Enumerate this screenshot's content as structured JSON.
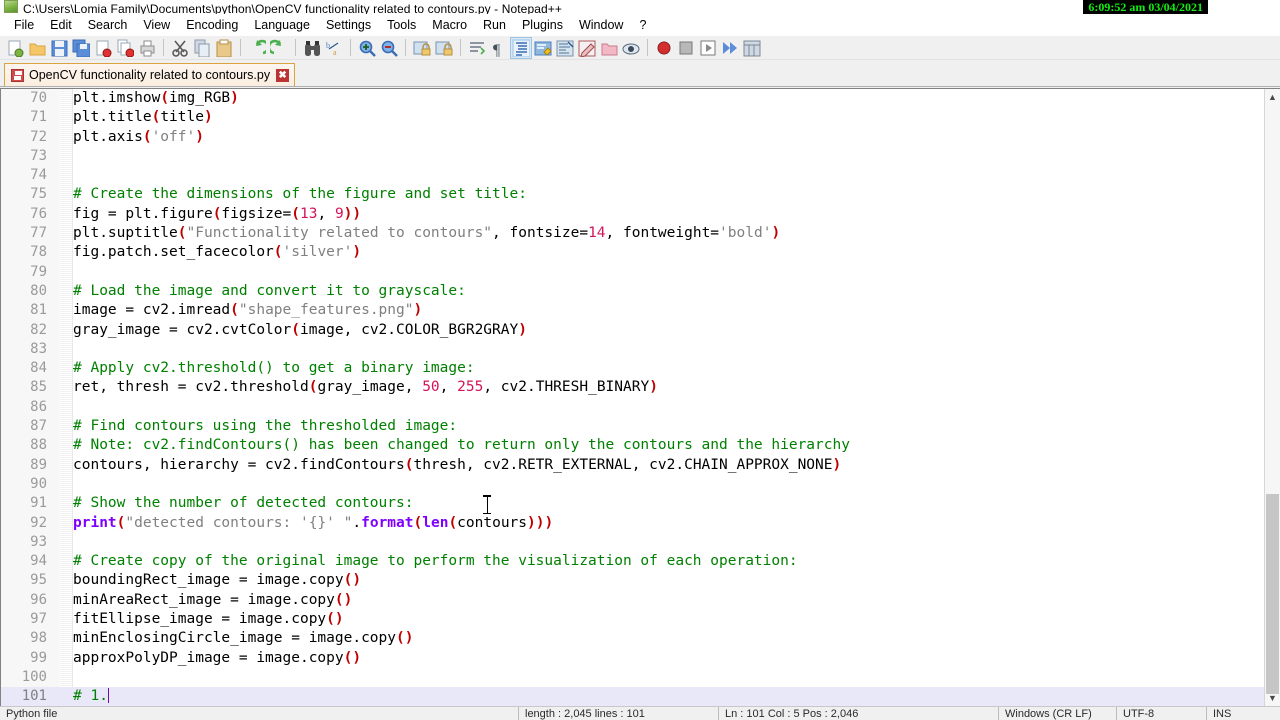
{
  "window": {
    "title": "C:\\Users\\Lomia Family\\Documents\\python\\OpenCV functionality related to contours.py - Notepad++",
    "app_icon": "notepad-plus-plus-icon",
    "close_label": "X",
    "clock_overlay": "6:09:52 am 03/04/2021"
  },
  "menubar": {
    "items": [
      {
        "label": "File"
      },
      {
        "label": "Edit"
      },
      {
        "label": "Search"
      },
      {
        "label": "View"
      },
      {
        "label": "Encoding"
      },
      {
        "label": "Language"
      },
      {
        "label": "Settings"
      },
      {
        "label": "Tools"
      },
      {
        "label": "Macro"
      },
      {
        "label": "Run"
      },
      {
        "label": "Plugins"
      },
      {
        "label": "Window"
      },
      {
        "label": "?"
      }
    ]
  },
  "toolbar": {
    "buttons": [
      {
        "name": "new-file-icon"
      },
      {
        "name": "open-file-icon"
      },
      {
        "name": "save-icon"
      },
      {
        "name": "save-all-icon"
      },
      {
        "name": "close-file-icon"
      },
      {
        "name": "close-all-files-icon"
      },
      {
        "name": "print-icon"
      },
      {
        "name": "separator"
      },
      {
        "name": "cut-icon"
      },
      {
        "name": "copy-icon"
      },
      {
        "name": "paste-icon"
      },
      {
        "name": "separator"
      },
      {
        "name": "undo-icon"
      },
      {
        "name": "redo-icon"
      },
      {
        "name": "separator"
      },
      {
        "name": "find-icon"
      },
      {
        "name": "replace-icon"
      },
      {
        "name": "separator"
      },
      {
        "name": "zoom-in-icon"
      },
      {
        "name": "zoom-out-icon"
      },
      {
        "name": "separator"
      },
      {
        "name": "sync-vertical-scroll-icon"
      },
      {
        "name": "sync-horizontal-scroll-icon"
      },
      {
        "name": "separator"
      },
      {
        "name": "word-wrap-icon"
      },
      {
        "name": "show-all-characters-icon"
      },
      {
        "name": "indent-guideline-icon"
      },
      {
        "name": "user-defined-dialog-icon"
      },
      {
        "name": "document-map-icon"
      },
      {
        "name": "function-list-icon"
      },
      {
        "name": "folder-as-workspace-icon"
      },
      {
        "name": "monitoring-icon"
      },
      {
        "name": "separator"
      },
      {
        "name": "record-macro-icon"
      },
      {
        "name": "stop-recording-icon"
      },
      {
        "name": "play-macro-icon"
      },
      {
        "name": "run-macro-multiple-icon"
      },
      {
        "name": "save-macro-icon"
      }
    ]
  },
  "tabs": [
    {
      "label": "OpenCV functionality related to contours.py",
      "icon": "saved-document-icon",
      "close_label": "✖",
      "active": true
    }
  ],
  "editor": {
    "first_visible_line": 70,
    "current_line": 101,
    "lines": [
      {
        "n": 70,
        "tokens": [
          {
            "t": "plt.imshow",
            "c": "op"
          },
          {
            "t": "(",
            "c": "par"
          },
          {
            "t": "img_RGB",
            "c": "op"
          },
          {
            "t": ")",
            "c": "par"
          }
        ]
      },
      {
        "n": 71,
        "tokens": [
          {
            "t": "plt.title",
            "c": "op"
          },
          {
            "t": "(",
            "c": "par"
          },
          {
            "t": "title",
            "c": "op"
          },
          {
            "t": ")",
            "c": "par"
          }
        ]
      },
      {
        "n": 72,
        "tokens": [
          {
            "t": "plt.axis",
            "c": "op"
          },
          {
            "t": "(",
            "c": "par"
          },
          {
            "t": "'off'",
            "c": "str"
          },
          {
            "t": ")",
            "c": "par"
          }
        ]
      },
      {
        "n": 73,
        "tokens": []
      },
      {
        "n": 74,
        "tokens": []
      },
      {
        "n": 75,
        "tokens": [
          {
            "t": "# Create the dimensions of the figure and set title:",
            "c": "com"
          }
        ]
      },
      {
        "n": 76,
        "tokens": [
          {
            "t": "fig = plt.figure",
            "c": "op"
          },
          {
            "t": "(",
            "c": "par"
          },
          {
            "t": "figsize=",
            "c": "op"
          },
          {
            "t": "(",
            "c": "par"
          },
          {
            "t": "13",
            "c": "num"
          },
          {
            "t": ", ",
            "c": "op"
          },
          {
            "t": "9",
            "c": "num"
          },
          {
            "t": "))",
            "c": "par"
          }
        ]
      },
      {
        "n": 77,
        "tokens": [
          {
            "t": "plt.suptitle",
            "c": "op"
          },
          {
            "t": "(",
            "c": "par"
          },
          {
            "t": "\"Functionality related to contours\"",
            "c": "str"
          },
          {
            "t": ", fontsize=",
            "c": "op"
          },
          {
            "t": "14",
            "c": "num"
          },
          {
            "t": ", fontweight=",
            "c": "op"
          },
          {
            "t": "'bold'",
            "c": "str"
          },
          {
            "t": ")",
            "c": "par"
          }
        ]
      },
      {
        "n": 78,
        "tokens": [
          {
            "t": "fig.patch.set_facecolor",
            "c": "op"
          },
          {
            "t": "(",
            "c": "par"
          },
          {
            "t": "'silver'",
            "c": "str"
          },
          {
            "t": ")",
            "c": "par"
          }
        ]
      },
      {
        "n": 79,
        "tokens": []
      },
      {
        "n": 80,
        "tokens": [
          {
            "t": "# Load the image and convert it to grayscale:",
            "c": "com"
          }
        ]
      },
      {
        "n": 81,
        "tokens": [
          {
            "t": "image = cv2.imread",
            "c": "op"
          },
          {
            "t": "(",
            "c": "par"
          },
          {
            "t": "\"shape_features.png\"",
            "c": "str"
          },
          {
            "t": ")",
            "c": "par"
          }
        ]
      },
      {
        "n": 82,
        "tokens": [
          {
            "t": "gray_image = cv2.cvtColor",
            "c": "op"
          },
          {
            "t": "(",
            "c": "par"
          },
          {
            "t": "image, cv2.COLOR_BGR2GRAY",
            "c": "op"
          },
          {
            "t": ")",
            "c": "par"
          }
        ]
      },
      {
        "n": 83,
        "tokens": []
      },
      {
        "n": 84,
        "tokens": [
          {
            "t": "# Apply cv2.threshold() to get a binary image:",
            "c": "com"
          }
        ]
      },
      {
        "n": 85,
        "tokens": [
          {
            "t": "ret, thresh = cv2.threshold",
            "c": "op"
          },
          {
            "t": "(",
            "c": "par"
          },
          {
            "t": "gray_image, ",
            "c": "op"
          },
          {
            "t": "50",
            "c": "num"
          },
          {
            "t": ", ",
            "c": "op"
          },
          {
            "t": "255",
            "c": "num"
          },
          {
            "t": ", cv2.THRESH_BINARY",
            "c": "op"
          },
          {
            "t": ")",
            "c": "par"
          }
        ]
      },
      {
        "n": 86,
        "tokens": []
      },
      {
        "n": 87,
        "tokens": [
          {
            "t": "# Find contours using the thresholded image:",
            "c": "com"
          }
        ]
      },
      {
        "n": 88,
        "tokens": [
          {
            "t": "# Note: cv2.findContours() has been changed to return only the contours and the hierarchy",
            "c": "com"
          }
        ]
      },
      {
        "n": 89,
        "tokens": [
          {
            "t": "contours, hierarchy = cv2.findContours",
            "c": "op"
          },
          {
            "t": "(",
            "c": "par"
          },
          {
            "t": "thresh, cv2.RETR_EXTERNAL, cv2.CHAIN_APPROX_NONE",
            "c": "op"
          },
          {
            "t": ")",
            "c": "par"
          }
        ]
      },
      {
        "n": 90,
        "tokens": []
      },
      {
        "n": 91,
        "tokens": [
          {
            "t": "# Show the number of detected contours:",
            "c": "com"
          }
        ]
      },
      {
        "n": 92,
        "tokens": [
          {
            "t": "print",
            "c": "kw"
          },
          {
            "t": "(",
            "c": "par"
          },
          {
            "t": "\"detected contours: '{}' \"",
            "c": "str"
          },
          {
            "t": ".",
            "c": "op"
          },
          {
            "t": "format",
            "c": "kw"
          },
          {
            "t": "(",
            "c": "par"
          },
          {
            "t": "len",
            "c": "kw"
          },
          {
            "t": "(",
            "c": "par"
          },
          {
            "t": "contours",
            "c": "op"
          },
          {
            "t": ")))",
            "c": "par"
          }
        ]
      },
      {
        "n": 93,
        "tokens": []
      },
      {
        "n": 94,
        "tokens": [
          {
            "t": "# Create copy of the original image to perform the visualization of each operation:",
            "c": "com"
          }
        ]
      },
      {
        "n": 95,
        "tokens": [
          {
            "t": "boundingRect_image = image.copy",
            "c": "op"
          },
          {
            "t": "()",
            "c": "par"
          }
        ]
      },
      {
        "n": 96,
        "tokens": [
          {
            "t": "minAreaRect_image = image.copy",
            "c": "op"
          },
          {
            "t": "()",
            "c": "par"
          }
        ]
      },
      {
        "n": 97,
        "tokens": [
          {
            "t": "fitEllipse_image = image.copy",
            "c": "op"
          },
          {
            "t": "()",
            "c": "par"
          }
        ]
      },
      {
        "n": 98,
        "tokens": [
          {
            "t": "minEnclosingCircle_image = image.copy",
            "c": "op"
          },
          {
            "t": "()",
            "c": "par"
          }
        ]
      },
      {
        "n": 99,
        "tokens": [
          {
            "t": "approxPolyDP_image = image.copy",
            "c": "op"
          },
          {
            "t": "()",
            "c": "par"
          }
        ]
      },
      {
        "n": 100,
        "tokens": []
      },
      {
        "n": 101,
        "tokens": [
          {
            "t": "# 1.",
            "c": "com"
          }
        ],
        "caret": true
      }
    ]
  },
  "statusbar": {
    "language": "Python file",
    "length_lines": "length : 2,045   lines : 101",
    "position": "Ln : 101   Col : 5   Pos : 2,046",
    "eol": "Windows (CR LF)",
    "encoding": "UTF-8",
    "insert_mode": "INS"
  },
  "colors": {
    "comment": "#008000",
    "string": "#808080",
    "number": "#d4145a",
    "paren": "#c00000",
    "keyword": "#8000ff",
    "current_line_bg": "#e8e8f8",
    "clock_green": "#11ee11",
    "tab_border": "#d9a441"
  }
}
